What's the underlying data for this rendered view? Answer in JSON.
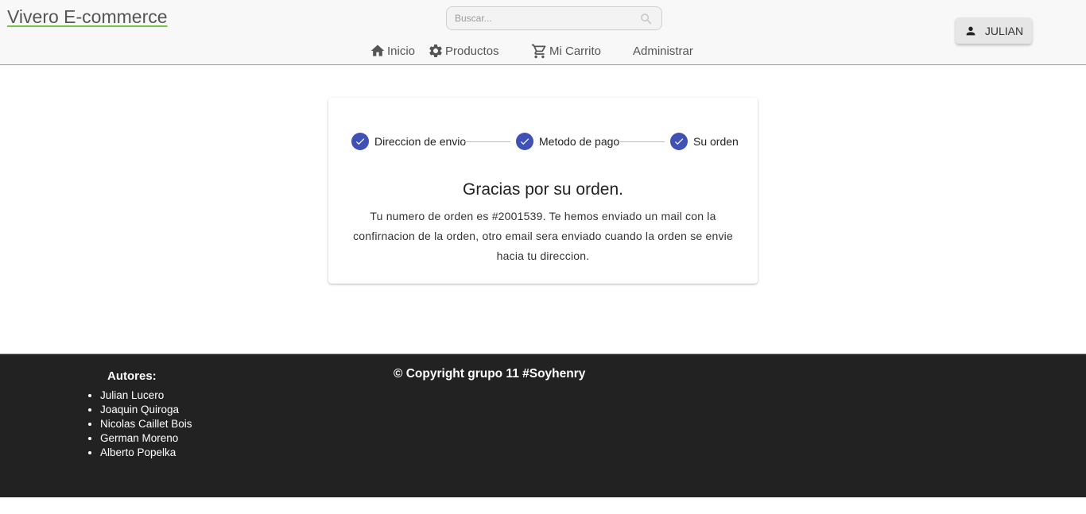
{
  "header": {
    "brand": "Vivero E-commerce",
    "search": {
      "placeholder": "Buscar..."
    },
    "nav": [
      {
        "label": "Inicio",
        "icon": "home-icon"
      },
      {
        "label": "Productos",
        "icon": "gear-icon"
      },
      {
        "label": "Mi Carrito",
        "icon": "cart-icon"
      },
      {
        "label": "Administrar"
      }
    ],
    "user": {
      "label": "JULIAN",
      "icon": "person-icon"
    }
  },
  "checkout": {
    "steps": [
      {
        "label": "Direccion de envio",
        "status": "completed"
      },
      {
        "label": "Metodo de pago",
        "status": "completed"
      },
      {
        "label": "Su orden",
        "status": "completed"
      }
    ],
    "title": "Gracias por su orden.",
    "message": "Tu numero de orden es #2001539. Te hemos enviado un mail con la confirnacion de la orden, otro email sera enviado cuando la orden se envie hacia tu direccion."
  },
  "footer": {
    "authors_title": "Autores:",
    "authors": [
      "Julian Lucero",
      "Joaquin Quiroga",
      "Nicolas Caillet Bois",
      "German Moreno",
      "Alberto Popelka"
    ],
    "copyright": "© Copyright grupo 11 #Soyhenry"
  },
  "colors": {
    "accent_green": "#76c043",
    "step_blue": "#3f51b5",
    "footer_bg": "#222222",
    "header_bg": "#f8f8f8"
  }
}
